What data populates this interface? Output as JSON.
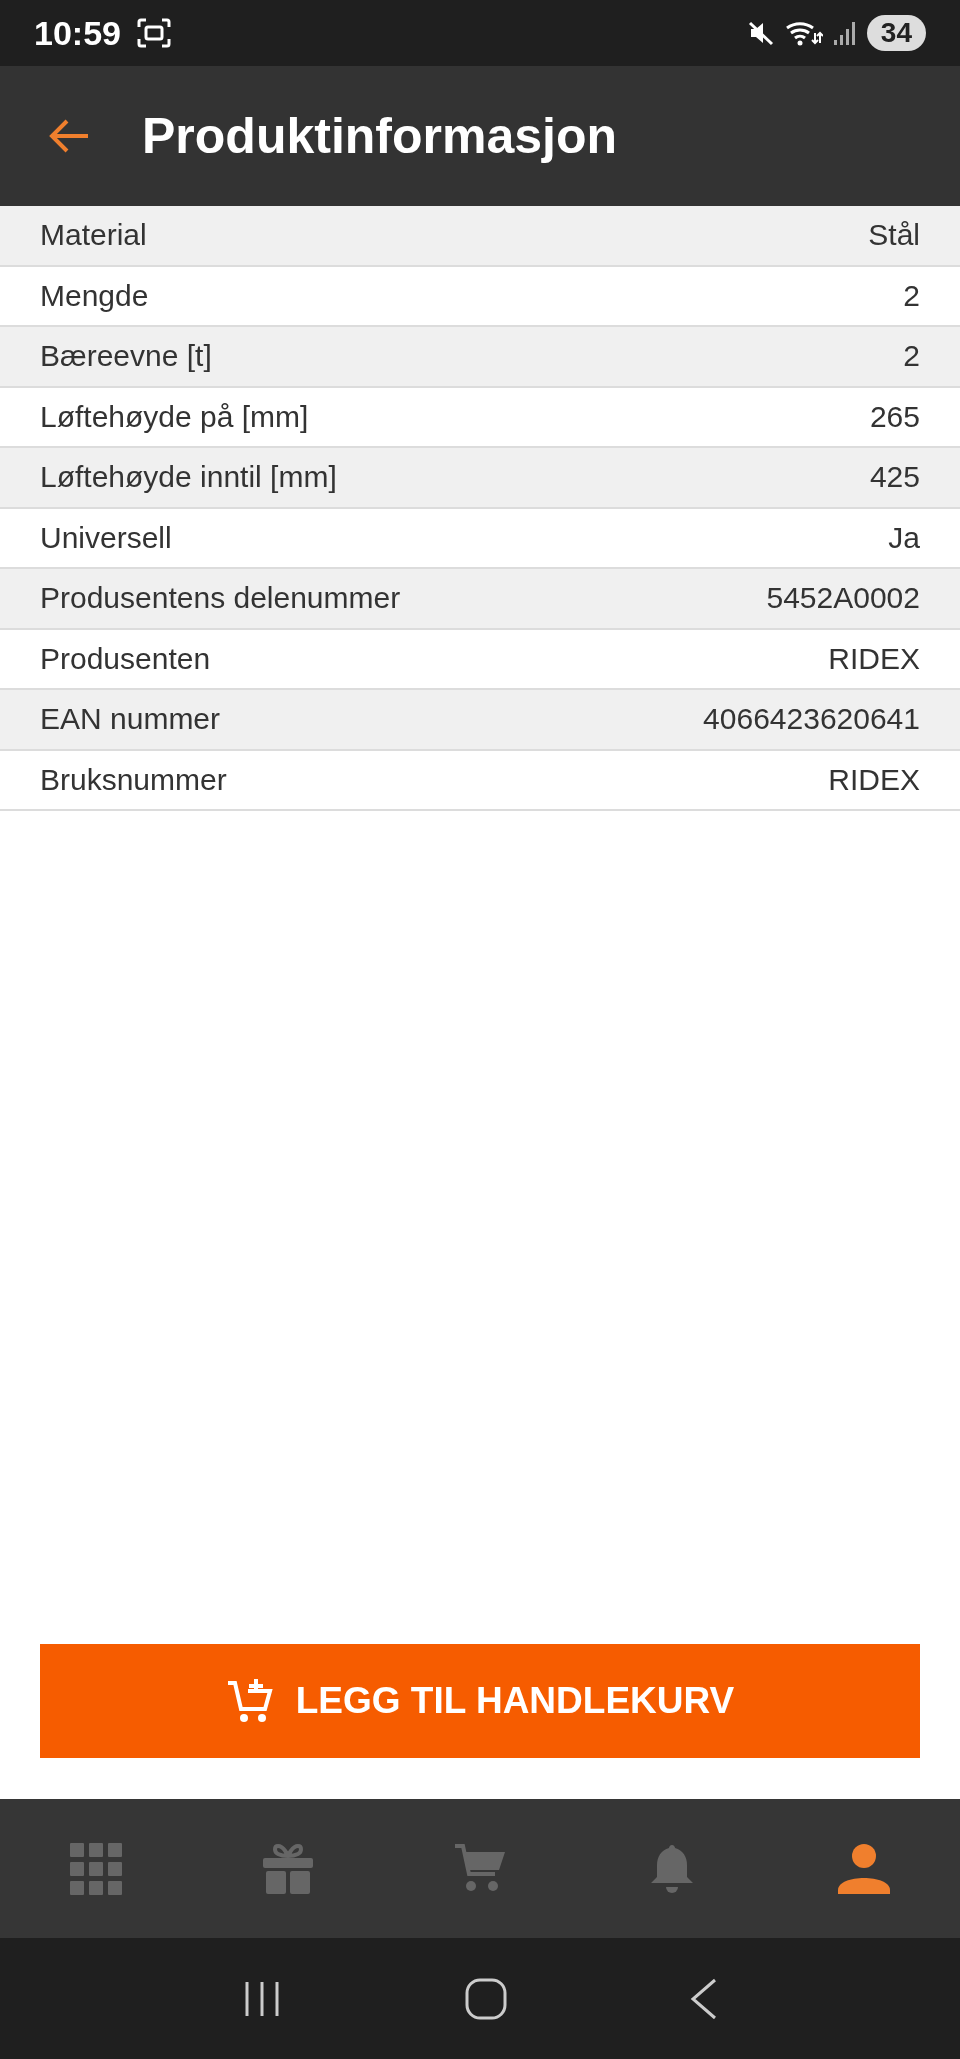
{
  "status_bar": {
    "time": "10:59",
    "battery": "34"
  },
  "header": {
    "title": "Produktinformasjon"
  },
  "rows": [
    {
      "label": "Material",
      "value": "Stål"
    },
    {
      "label": "Mengde",
      "value": "2"
    },
    {
      "label": "Bæreevne [t]",
      "value": "2"
    },
    {
      "label": "Løftehøyde på [mm]",
      "value": "265"
    },
    {
      "label": "Løftehøyde inntil [mm]",
      "value": "425"
    },
    {
      "label": "Universell",
      "value": "Ja"
    },
    {
      "label": "Produsentens delenummer",
      "value": "5452A0002"
    },
    {
      "label": "Produsenten",
      "value": "RIDEX"
    },
    {
      "label": "EAN nummer",
      "value": "4066423620641"
    },
    {
      "label": "Bruksnummer",
      "value": "RIDEX"
    }
  ],
  "cart_button": {
    "label": "LEGG TIL HANDLEKURV"
  },
  "bottom_nav": [
    {
      "kind": "grid",
      "selected": false
    },
    {
      "kind": "gift",
      "selected": false
    },
    {
      "kind": "cart",
      "selected": false
    },
    {
      "kind": "bell",
      "selected": false
    },
    {
      "kind": "person",
      "selected": true
    }
  ]
}
